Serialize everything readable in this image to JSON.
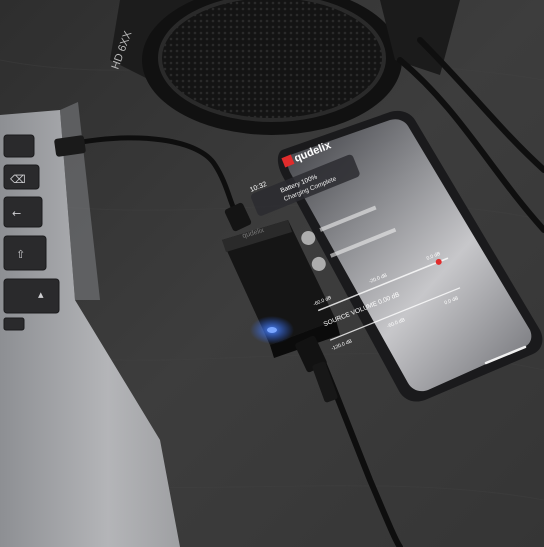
{
  "photo": {
    "headphones": {
      "model_text": "HD 6XX"
    },
    "phone": {
      "clock": "10:32",
      "app_logo": "qudelix",
      "notification_title": "Battery 100%",
      "notification_subtitle": "Charging Complete",
      "volume_label": "SOURCE VOLUME 0.00 dB",
      "scale_left": "-60.0 dB",
      "scale_mid": "-20.0 dB",
      "scale_right": "0.0 dB",
      "lower_scale_left": "-120.0 dB",
      "lower_scale_mid": "-60.0 dB",
      "lower_scale_right": "0.0 dB"
    },
    "dac": {
      "brand": "qudelix"
    },
    "colors": {
      "table": "#3b3b3b",
      "laptop": "#a9aaad",
      "keys": "#2a2a2c",
      "phone_body": "#1a1a1c",
      "dac_body": "#151515",
      "led": "#2f6bff",
      "slider_accent": "#e02c2c"
    }
  }
}
